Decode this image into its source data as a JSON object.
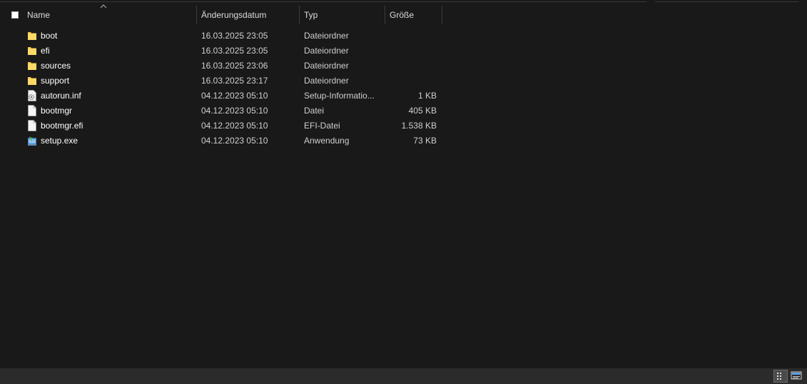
{
  "header": {
    "name": "Name",
    "date": "Änderungsdatum",
    "type": "Typ",
    "size": "Größe"
  },
  "files": [
    {
      "name": "boot",
      "date": "16.03.2025 23:05",
      "type": "Dateiordner",
      "size": "",
      "icon": "folder-icon"
    },
    {
      "name": "efi",
      "date": "16.03.2025 23:05",
      "type": "Dateiordner",
      "size": "",
      "icon": "folder-icon"
    },
    {
      "name": "sources",
      "date": "16.03.2025 23:06",
      "type": "Dateiordner",
      "size": "",
      "icon": "folder-icon"
    },
    {
      "name": "support",
      "date": "16.03.2025 23:17",
      "type": "Dateiordner",
      "size": "",
      "icon": "folder-icon"
    },
    {
      "name": "autorun.inf",
      "date": "04.12.2023 05:10",
      "type": "Setup-Informatio...",
      "size": "1 KB",
      "icon": "settings-file-icon"
    },
    {
      "name": "bootmgr",
      "date": "04.12.2023 05:10",
      "type": "Datei",
      "size": "405 KB",
      "icon": "file-icon"
    },
    {
      "name": "bootmgr.efi",
      "date": "04.12.2023 05:10",
      "type": "EFI-Datei",
      "size": "1.538 KB",
      "icon": "file-icon"
    },
    {
      "name": "setup.exe",
      "date": "04.12.2023 05:10",
      "type": "Anwendung",
      "size": "73 KB",
      "icon": "setup-exe-icon"
    }
  ],
  "statusbar": {
    "details_view_icon": "details-view-icon",
    "tiles_view_icon": "tiles-view-icon"
  },
  "colors": {
    "background": "#191919",
    "folder": "#f7c948",
    "statusbar": "#2b2b2b"
  }
}
